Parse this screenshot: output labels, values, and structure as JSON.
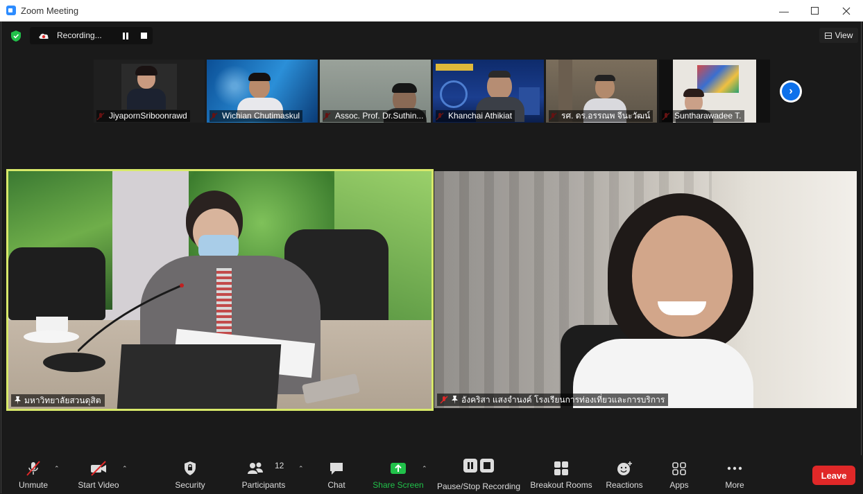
{
  "window": {
    "title": "Zoom Meeting"
  },
  "topbar": {
    "recording_label": "Recording...",
    "view_label": "View"
  },
  "thumbnails": [
    {
      "name": "JiyapornSriboonrawd"
    },
    {
      "name": "Wichian Chutimaskul"
    },
    {
      "name": "Assoc. Prof. Dr.Suthin..."
    },
    {
      "name": "Khanchai Athikiat"
    },
    {
      "name": "รศ. ดร.อรรณพ จีนะวัฒน์"
    },
    {
      "name": "Suntharawadee T."
    }
  ],
  "main_tiles": [
    {
      "name": "มหาวิทยาลัยสวนดุสิต"
    },
    {
      "name": "อังคริสา แสงจำนงค์ โรงเรียนการท่องเที่ยวและการบริการ"
    }
  ],
  "toolbar": {
    "unmute": "Unmute",
    "start_video": "Start Video",
    "security": "Security",
    "participants": "Participants",
    "participants_count": "12",
    "chat": "Chat",
    "share_screen": "Share Screen",
    "pause_stop_recording": "Pause/Stop Recording",
    "breakout_rooms": "Breakout Rooms",
    "reactions": "Reactions",
    "apps": "Apps",
    "more": "More",
    "leave": "Leave"
  },
  "colors": {
    "accent": "#0e71eb",
    "active_speaker_border": "#d8e96a",
    "share_green": "#21c14a",
    "leave_red": "#e02828",
    "muted_red": "#e02828"
  }
}
